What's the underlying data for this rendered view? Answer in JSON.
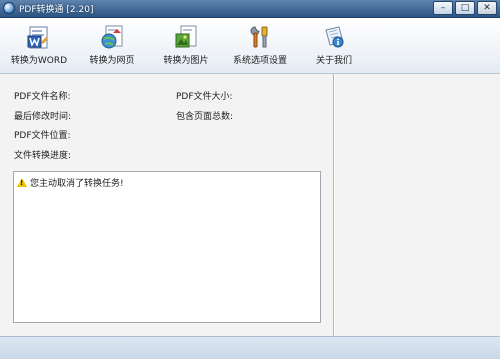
{
  "window": {
    "title": "PDF转换通 [2.20]",
    "minimize_glyph": "–",
    "maximize_glyph": "□",
    "close_glyph": "✕"
  },
  "toolbar": {
    "items": [
      {
        "label": "转换为WORD",
        "icon": "word-document-icon"
      },
      {
        "label": "转换为网页",
        "icon": "web-page-icon"
      },
      {
        "label": "转换为图片",
        "icon": "image-file-icon"
      },
      {
        "label": "系统选项设置",
        "icon": "settings-tools-icon"
      },
      {
        "label": "关于我们",
        "icon": "about-info-icon"
      }
    ]
  },
  "info": {
    "pdf_name_label": "PDF文件名称:",
    "pdf_size_label": "PDF文件大小:",
    "last_modified_label": "最后修改时间:",
    "page_count_label": "包含页面总数:",
    "pdf_location_label": "PDF文件位置:",
    "progress_label": "文件转换进度:"
  },
  "log": {
    "entries": [
      {
        "icon": "warning-icon",
        "text": "您主动取消了转换任务!"
      }
    ]
  },
  "colors": {
    "titlebar": "#3b6592",
    "accent": "#2c5583",
    "warning": "#f2c200"
  }
}
